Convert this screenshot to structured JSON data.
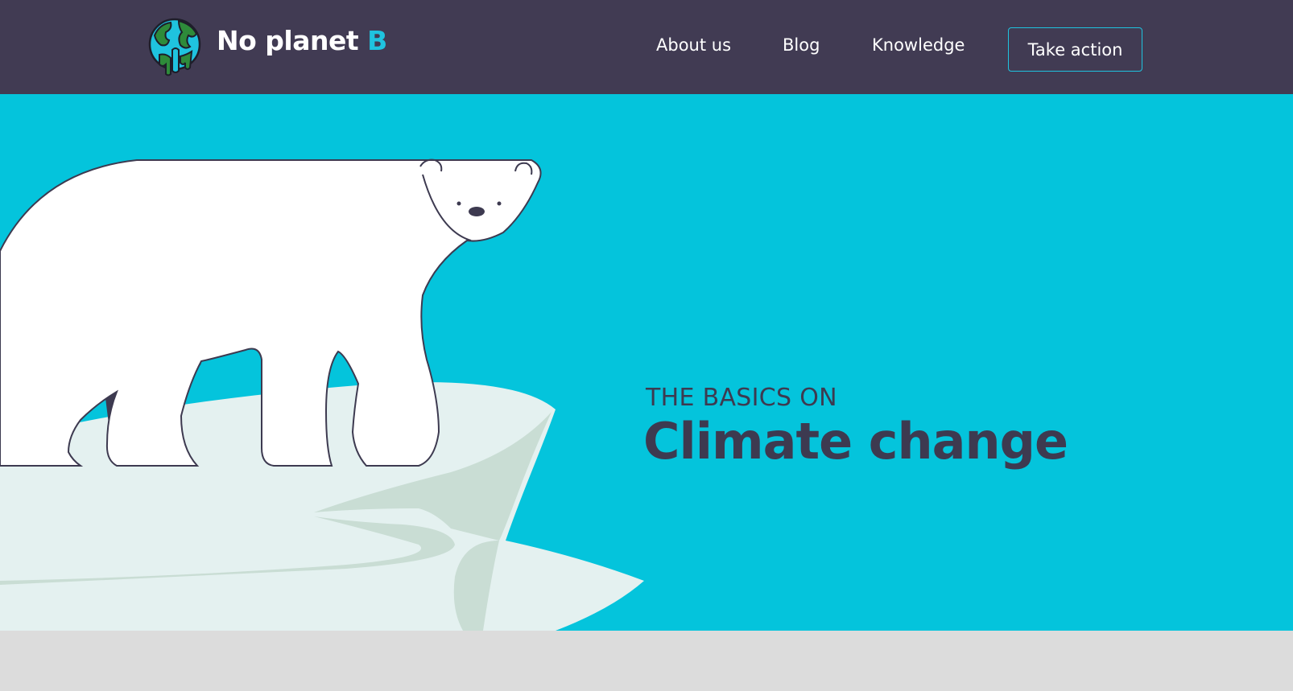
{
  "brand": {
    "name": "No planet ",
    "accent": "B",
    "logo_icon": "melting-globe-icon",
    "accent_color": "#1fc3df"
  },
  "nav": {
    "items": [
      {
        "label": "About us"
      },
      {
        "label": "Blog"
      },
      {
        "label": "Knowledge"
      }
    ],
    "cta_label": "Take action"
  },
  "hero": {
    "kicker": "THE BASICS ON",
    "headline": "Climate change",
    "illustration": "polar-bear-on-ice-floe",
    "background_color": "#04c4dc",
    "text_color": "#3d3a50"
  },
  "colors": {
    "header_bg": "#413b53",
    "page_bg": "#dcdcdc"
  }
}
